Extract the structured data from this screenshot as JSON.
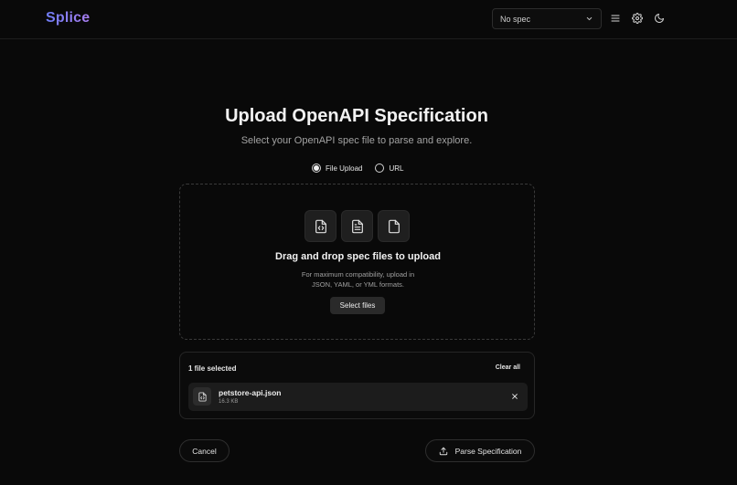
{
  "header": {
    "brand": "Splice",
    "spec_select_value": "No spec",
    "icons": [
      "menu-icon",
      "gear-icon",
      "moon-icon"
    ]
  },
  "upload": {
    "title": "Upload OpenAPI Specification",
    "subtitle": "Select your OpenAPI spec file to parse and explore.",
    "modes": [
      {
        "label": "File Upload",
        "selected": true
      },
      {
        "label": "URL",
        "selected": false
      }
    ]
  },
  "dropzone": {
    "icons": [
      "file-code-icon",
      "file-text-icon",
      "file-icon"
    ],
    "title": "Drag and drop spec files to upload",
    "description_line1": "For maximum compatibility, upload in",
    "description_line2": "JSON, YAML, or YML formats.",
    "select_label": "Select files"
  },
  "files": {
    "count_label": "1 file selected",
    "clear_label": "Clear all",
    "items": [
      {
        "name": "petstore-api.json",
        "size": "16.3 KB"
      }
    ]
  },
  "actions": {
    "cancel_label": "Cancel",
    "parse_label": "Parse Specification"
  },
  "colors": {
    "background": "#090909",
    "brand_start": "#6e7cf4",
    "brand_end": "#a87ef0",
    "surface": "#1c1c1c"
  }
}
